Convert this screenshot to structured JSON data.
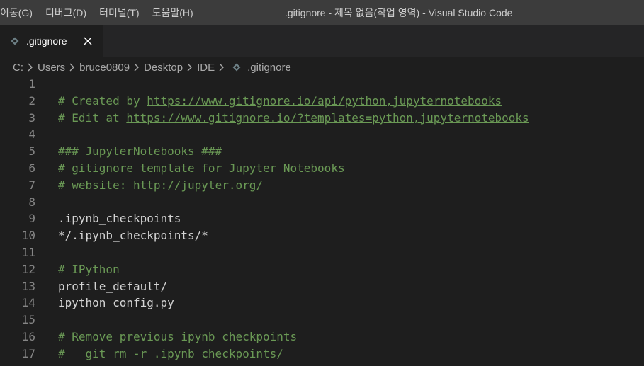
{
  "menu": [
    "이동(G)",
    "디버그(D)",
    "터미널(T)",
    "도움말(H)"
  ],
  "window_title": ".gitignore - 제목 없음(작업 영역) - Visual Studio Code",
  "tabs": [
    {
      "label": ".gitignore",
      "icon": "gitignore-file-icon",
      "close_icon": "close-icon",
      "active": true
    }
  ],
  "breadcrumb": [
    "C:",
    "Users",
    "bruce0809",
    "Desktop",
    "IDE",
    ".gitignore"
  ],
  "colors": {
    "titlebar": "#3c3c3c",
    "tabbar": "#252526",
    "editor_bg": "#1e1e1e",
    "comment": "#6a9955",
    "text": "#d4d4d4",
    "line_number": "#858585"
  },
  "editor": {
    "lines": [
      {
        "n": "1",
        "parts": []
      },
      {
        "n": "2",
        "parts": [
          {
            "t": "# Created by ",
            "k": "comment"
          },
          {
            "t": "https://www.gitignore.io/api/python,jupyternotebooks",
            "k": "link"
          }
        ]
      },
      {
        "n": "3",
        "parts": [
          {
            "t": "# Edit at ",
            "k": "comment"
          },
          {
            "t": "https://www.gitignore.io/?templates=python,jupyternotebooks",
            "k": "link"
          }
        ]
      },
      {
        "n": "4",
        "parts": []
      },
      {
        "n": "5",
        "parts": [
          {
            "t": "### JupyterNotebooks ###",
            "k": "comment"
          }
        ]
      },
      {
        "n": "6",
        "parts": [
          {
            "t": "# gitignore template for Jupyter Notebooks",
            "k": "comment"
          }
        ]
      },
      {
        "n": "7",
        "parts": [
          {
            "t": "# website: ",
            "k": "comment"
          },
          {
            "t": "http://jupyter.org/",
            "k": "link"
          }
        ]
      },
      {
        "n": "8",
        "parts": []
      },
      {
        "n": "9",
        "parts": [
          {
            "t": ".ipynb_checkpoints",
            "k": "text"
          }
        ]
      },
      {
        "n": "10",
        "parts": [
          {
            "t": "*/.ipynb_checkpoints/*",
            "k": "text"
          }
        ]
      },
      {
        "n": "11",
        "parts": []
      },
      {
        "n": "12",
        "parts": [
          {
            "t": "# IPython",
            "k": "comment"
          }
        ]
      },
      {
        "n": "13",
        "parts": [
          {
            "t": "profile_default/",
            "k": "text"
          }
        ]
      },
      {
        "n": "14",
        "parts": [
          {
            "t": "ipython_config.py",
            "k": "text"
          }
        ]
      },
      {
        "n": "15",
        "parts": []
      },
      {
        "n": "16",
        "parts": [
          {
            "t": "# Remove previous ipynb_checkpoints",
            "k": "comment"
          }
        ]
      },
      {
        "n": "17",
        "parts": [
          {
            "t": "#   git rm -r .ipynb_checkpoints/",
            "k": "comment"
          }
        ]
      }
    ]
  }
}
